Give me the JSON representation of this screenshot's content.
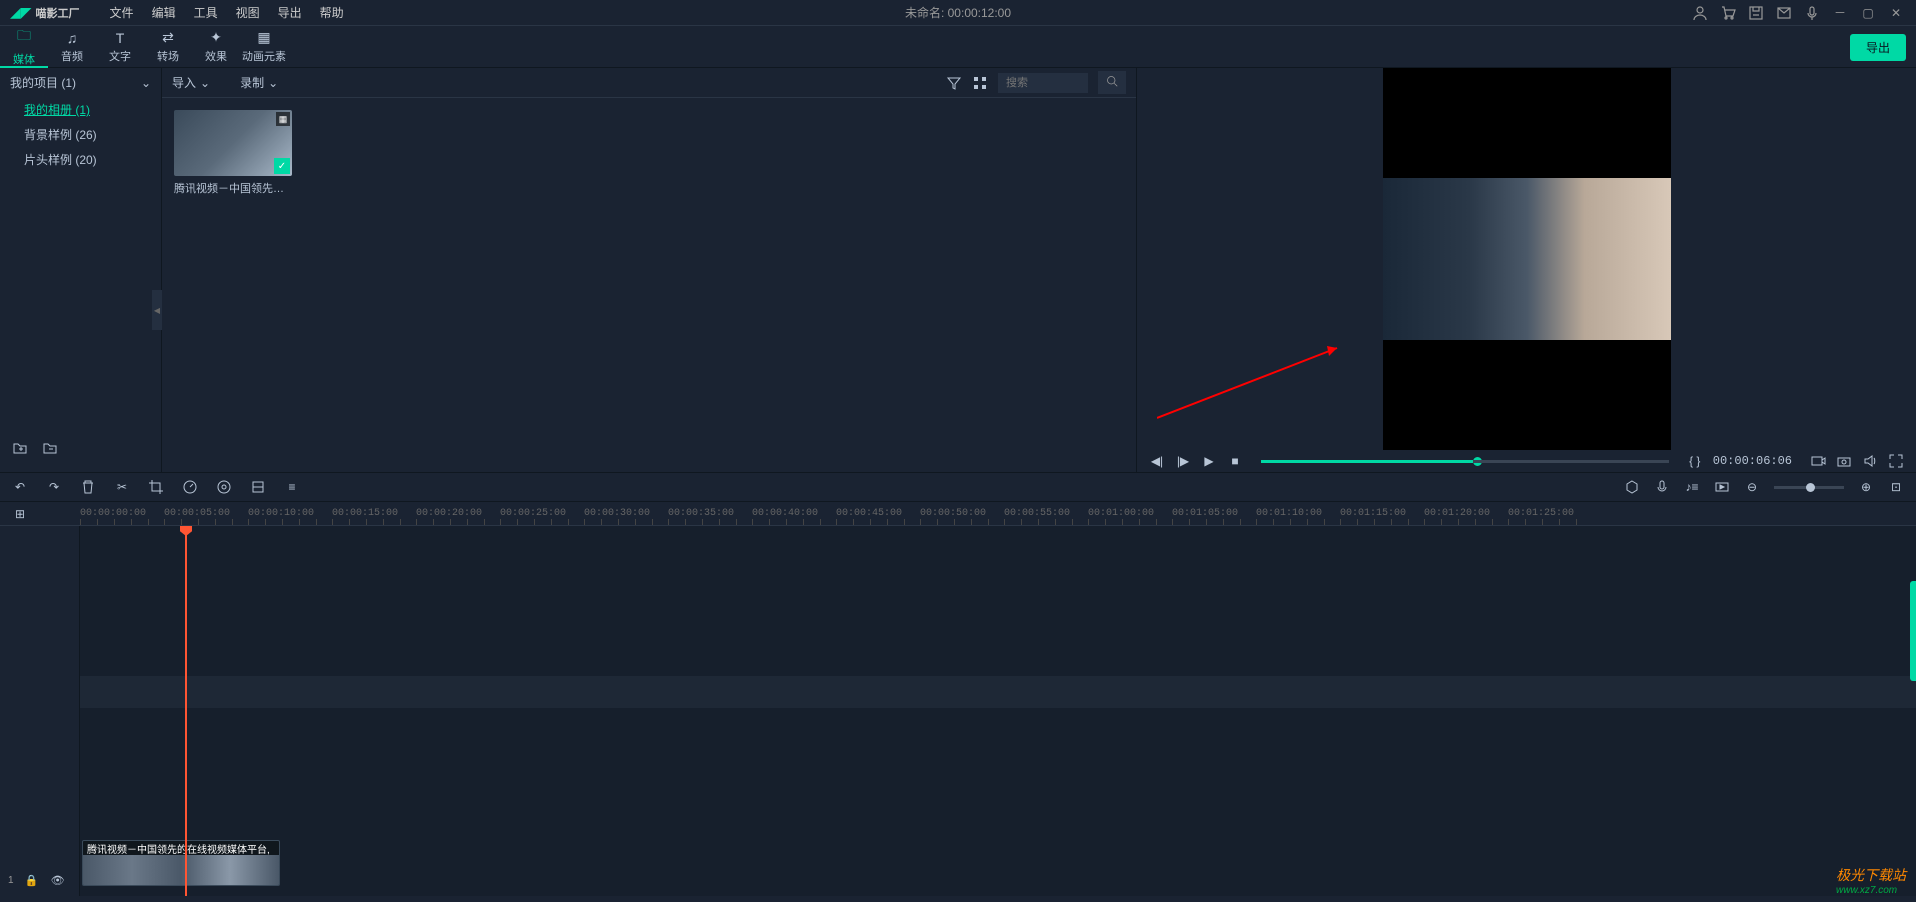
{
  "app": {
    "logo_text": "喵影工厂",
    "title": "未命名: 00:00:12:00"
  },
  "menu": {
    "file": "文件",
    "edit": "编辑",
    "tool": "工具",
    "view": "视图",
    "export": "导出",
    "help": "帮助"
  },
  "tabs": {
    "media": {
      "label": "媒体"
    },
    "audio": {
      "label": "音频"
    },
    "text": {
      "label": "文字"
    },
    "trans": {
      "label": "转场"
    },
    "effect": {
      "label": "效果"
    },
    "anim": {
      "label": "动画元素"
    }
  },
  "export_btn": "导出",
  "sidebar": {
    "project_header": "我的项目 (1)",
    "album": "我的相册 (1)",
    "bg": "背景样例 (26)",
    "intro": "片头样例 (20)"
  },
  "media_toolbar": {
    "import": "导入",
    "record": "录制"
  },
  "search": {
    "placeholder": "搜索"
  },
  "media_item": {
    "label": "腾讯视频－中国领先的在"
  },
  "preview": {
    "timecode": "00:00:06:06",
    "markers": "{ }"
  },
  "ruler": [
    "00:00:00:00",
    "00:00:05:00",
    "00:00:10:00",
    "00:00:15:00",
    "00:00:20:00",
    "00:00:25:00",
    "00:00:30:00",
    "00:00:35:00",
    "00:00:40:00",
    "00:00:45:00",
    "00:00:50:00",
    "00:00:55:00",
    "00:01:00:00",
    "00:01:05:00",
    "00:01:10:00",
    "00:01:15:00",
    "00:01:20:00",
    "00:01:25:00"
  ],
  "clip": {
    "title": "腾讯视频－中国领先的在线视频媒体平台,"
  },
  "track_label": "1",
  "adjust_icon": "⊞",
  "watermark": {
    "site": "极光下载站",
    "url": "www.xz7.com"
  }
}
